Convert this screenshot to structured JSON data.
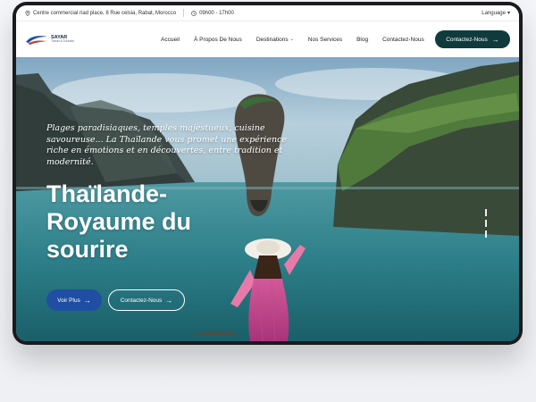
{
  "topbar": {
    "address": "Centre commercial riad place, 8 Rue celsia, Rabat, Morocco",
    "hours": "09h00 - 17h00",
    "language": "Language"
  },
  "logo": {
    "name": "SAYAR",
    "sub": "Travel & Tourism"
  },
  "nav": {
    "items": [
      {
        "label": "Accueil"
      },
      {
        "label": "À Propos De Nous"
      },
      {
        "label": "Destinations"
      },
      {
        "label": "Nos Services"
      },
      {
        "label": "Blog"
      },
      {
        "label": "Contactez-Nous"
      }
    ],
    "cta": "Contactez-Nous"
  },
  "hero": {
    "tagline": "Plages paradisiaques, temples majestueux, cuisine savoureuse... La Thaïlande vous promet une expérience riche en émotions et en découvertes, entre tradition et modernité.",
    "title": "Thaïlande-Royaume du sourire",
    "primary_button": "Voir Plus",
    "secondary_button": "Contactez-Nous"
  },
  "icons": {
    "pin": "map-pin-icon",
    "clock": "clock-icon",
    "chevron": "chevron-down-icon",
    "arrow": "arrow-right-icon"
  },
  "colors": {
    "cta": "#0f3b3d",
    "primary_button": "#1f4ea3"
  }
}
